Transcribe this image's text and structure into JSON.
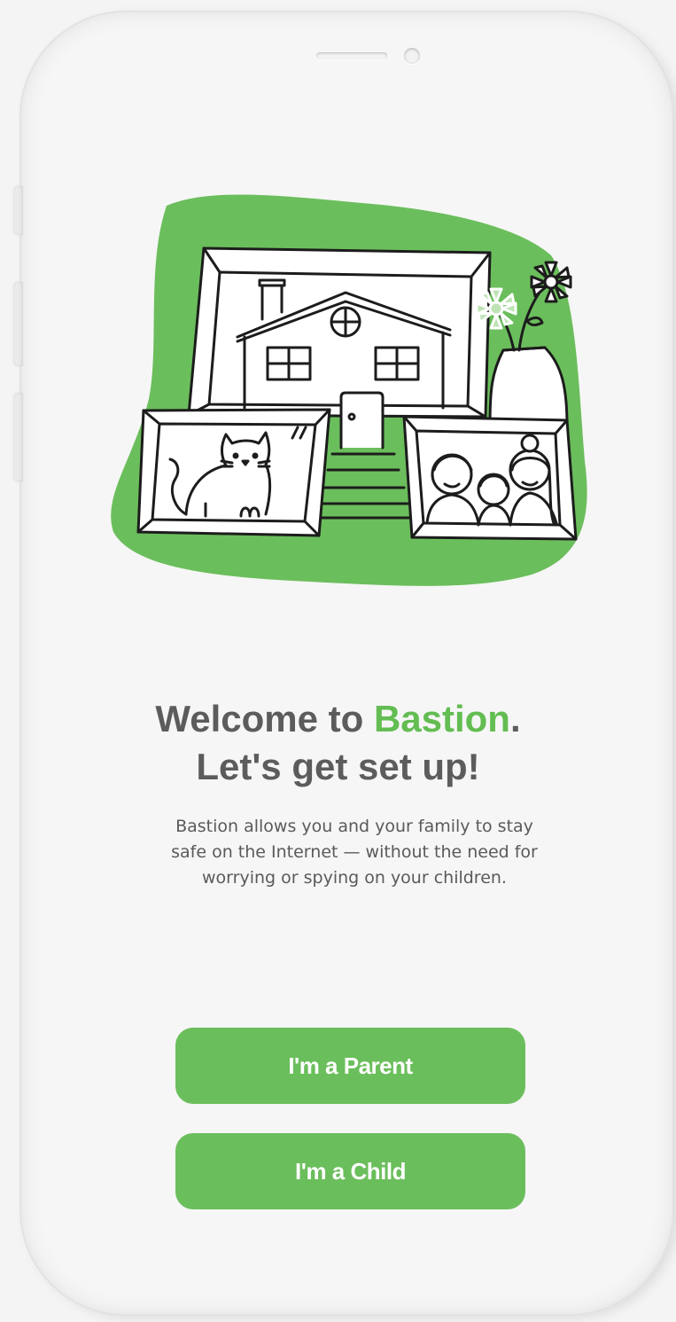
{
  "welcome": {
    "line1_prefix": "Welcome to ",
    "brand_name": "Bastion",
    "line1_suffix": ".",
    "line2": "Let's get set up!",
    "description_lines": [
      "Bastion allows you and your family to stay",
      "safe on the Internet — without the need for",
      "worrying or spying on your children."
    ]
  },
  "actions": {
    "parent_label": "I'm a Parent",
    "child_label": "I'm a Child"
  },
  "illustration": {
    "subject": "house-with-framed-photos-and-flower-vase"
  },
  "colors": {
    "brand_green": "#63bd52",
    "button_green": "#6bbe5c",
    "heading_gray": "#5c5c5c",
    "body_gray": "#5a5a5a",
    "background": "#f6f6f6"
  }
}
